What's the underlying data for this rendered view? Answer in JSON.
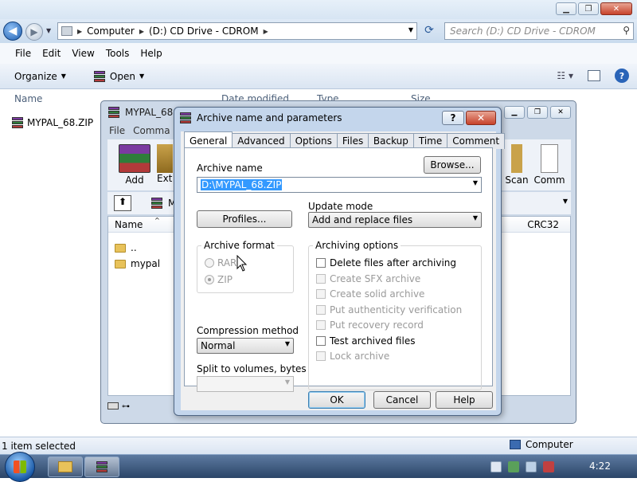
{
  "explorer": {
    "address": {
      "crumbs": [
        "Computer",
        "(D:) CD Drive - CDROM"
      ]
    },
    "search": {
      "placeholder": "Search (D:) CD Drive - CDROM"
    },
    "menu": [
      "File",
      "Edit",
      "View",
      "Tools",
      "Help"
    ],
    "toolbar": {
      "organize": "Organize",
      "open": "Open"
    },
    "columns": {
      "name": "Name",
      "date": "Date modified",
      "type": "Type",
      "size": "Size"
    },
    "file": {
      "name": "MYPAL_68.ZIP"
    },
    "status": {
      "selected": "1 item selected",
      "location": "Computer"
    }
  },
  "winrar": {
    "title": "MYPAL_68.2",
    "menu": [
      "File",
      "Comma"
    ],
    "toolbar": {
      "add": "Add",
      "extract": "Ext",
      "scan": "Scan",
      "comment": "Comm"
    },
    "path_prefix": "M",
    "columns": {
      "name": "Name",
      "crc": "CRC32"
    },
    "rows": [
      "..",
      "mypal"
    ]
  },
  "dialog": {
    "title": "Archive name and parameters",
    "help_label": "?",
    "tabs": [
      "General",
      "Advanced",
      "Options",
      "Files",
      "Backup",
      "Time",
      "Comment"
    ],
    "archive_name_label": "Archive name",
    "browse": "Browse...",
    "archive_name_value": "D:\\MYPAL_68.ZIP",
    "profiles": "Profiles...",
    "update_mode_label": "Update mode",
    "update_mode_value": "Add and replace files",
    "archive_format_label": "Archive format",
    "format_rar": "RAR",
    "format_zip": "ZIP",
    "format_selected": "ZIP",
    "compression_label": "Compression method",
    "compression_value": "Normal",
    "split_label": "Split to volumes, bytes",
    "split_value": "",
    "archiving_options_label": "Archiving options",
    "options": [
      {
        "label": "Delete files after archiving",
        "checked": false,
        "enabled": true
      },
      {
        "label": "Create SFX archive",
        "checked": false,
        "enabled": false
      },
      {
        "label": "Create solid archive",
        "checked": false,
        "enabled": false
      },
      {
        "label": "Put authenticity verification",
        "checked": false,
        "enabled": false
      },
      {
        "label": "Put recovery record",
        "checked": false,
        "enabled": false
      },
      {
        "label": "Test archived files",
        "checked": false,
        "enabled": true
      },
      {
        "label": "Lock archive",
        "checked": false,
        "enabled": false
      }
    ],
    "ok": "OK",
    "cancel": "Cancel",
    "help": "Help"
  },
  "taskbar": {
    "clock": "4:22"
  },
  "colors": {
    "accent": "#3399ff",
    "title_bg": "#c4d6ec",
    "disabled_text": "#9a9a9a"
  }
}
